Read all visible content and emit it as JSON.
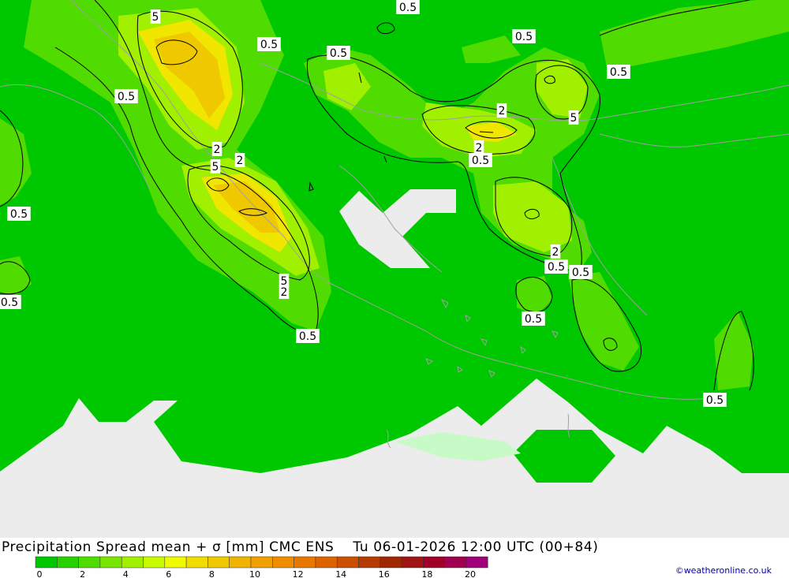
{
  "title": "Precipitation Spread mean + σ [mm] CMC ENS    Tu 06-01-2026 12:00 UTC (00+84)",
  "credit": "©weatheronline.co.uk",
  "legend": {
    "ticks": [
      "0",
      "2",
      "4",
      "6",
      "8",
      "10",
      "12",
      "14",
      "16",
      "18",
      "20"
    ],
    "colors": [
      "#00c800",
      "#28d200",
      "#50dc00",
      "#78e600",
      "#a0f000",
      "#c8fa00",
      "#f0fa00",
      "#f0dc00",
      "#f0c800",
      "#f0b400",
      "#f0a000",
      "#f08c00",
      "#e67800",
      "#dc6400",
      "#c85000",
      "#b43c00",
      "#a02800",
      "#a01414",
      "#a00028",
      "#a00050",
      "#a00078"
    ]
  },
  "contour_labels": [
    "0.5",
    "0.5",
    "0.5",
    "0.5",
    "0.5",
    "0.5",
    "0.5",
    "0.5",
    "0.5",
    "0.5",
    "0.5",
    "0.5",
    "0.5",
    "0.5",
    "5",
    "2",
    "2",
    "5",
    "2",
    "5",
    "2",
    "2",
    "5",
    "2",
    "5",
    "2",
    "2"
  ],
  "colors": {
    "base_green": "#00c800",
    "light_green": "#50dc00",
    "yellow_green": "#a0f000",
    "yellow": "#f0e600",
    "orange": "#f0b400",
    "nodata": "#ececec"
  }
}
